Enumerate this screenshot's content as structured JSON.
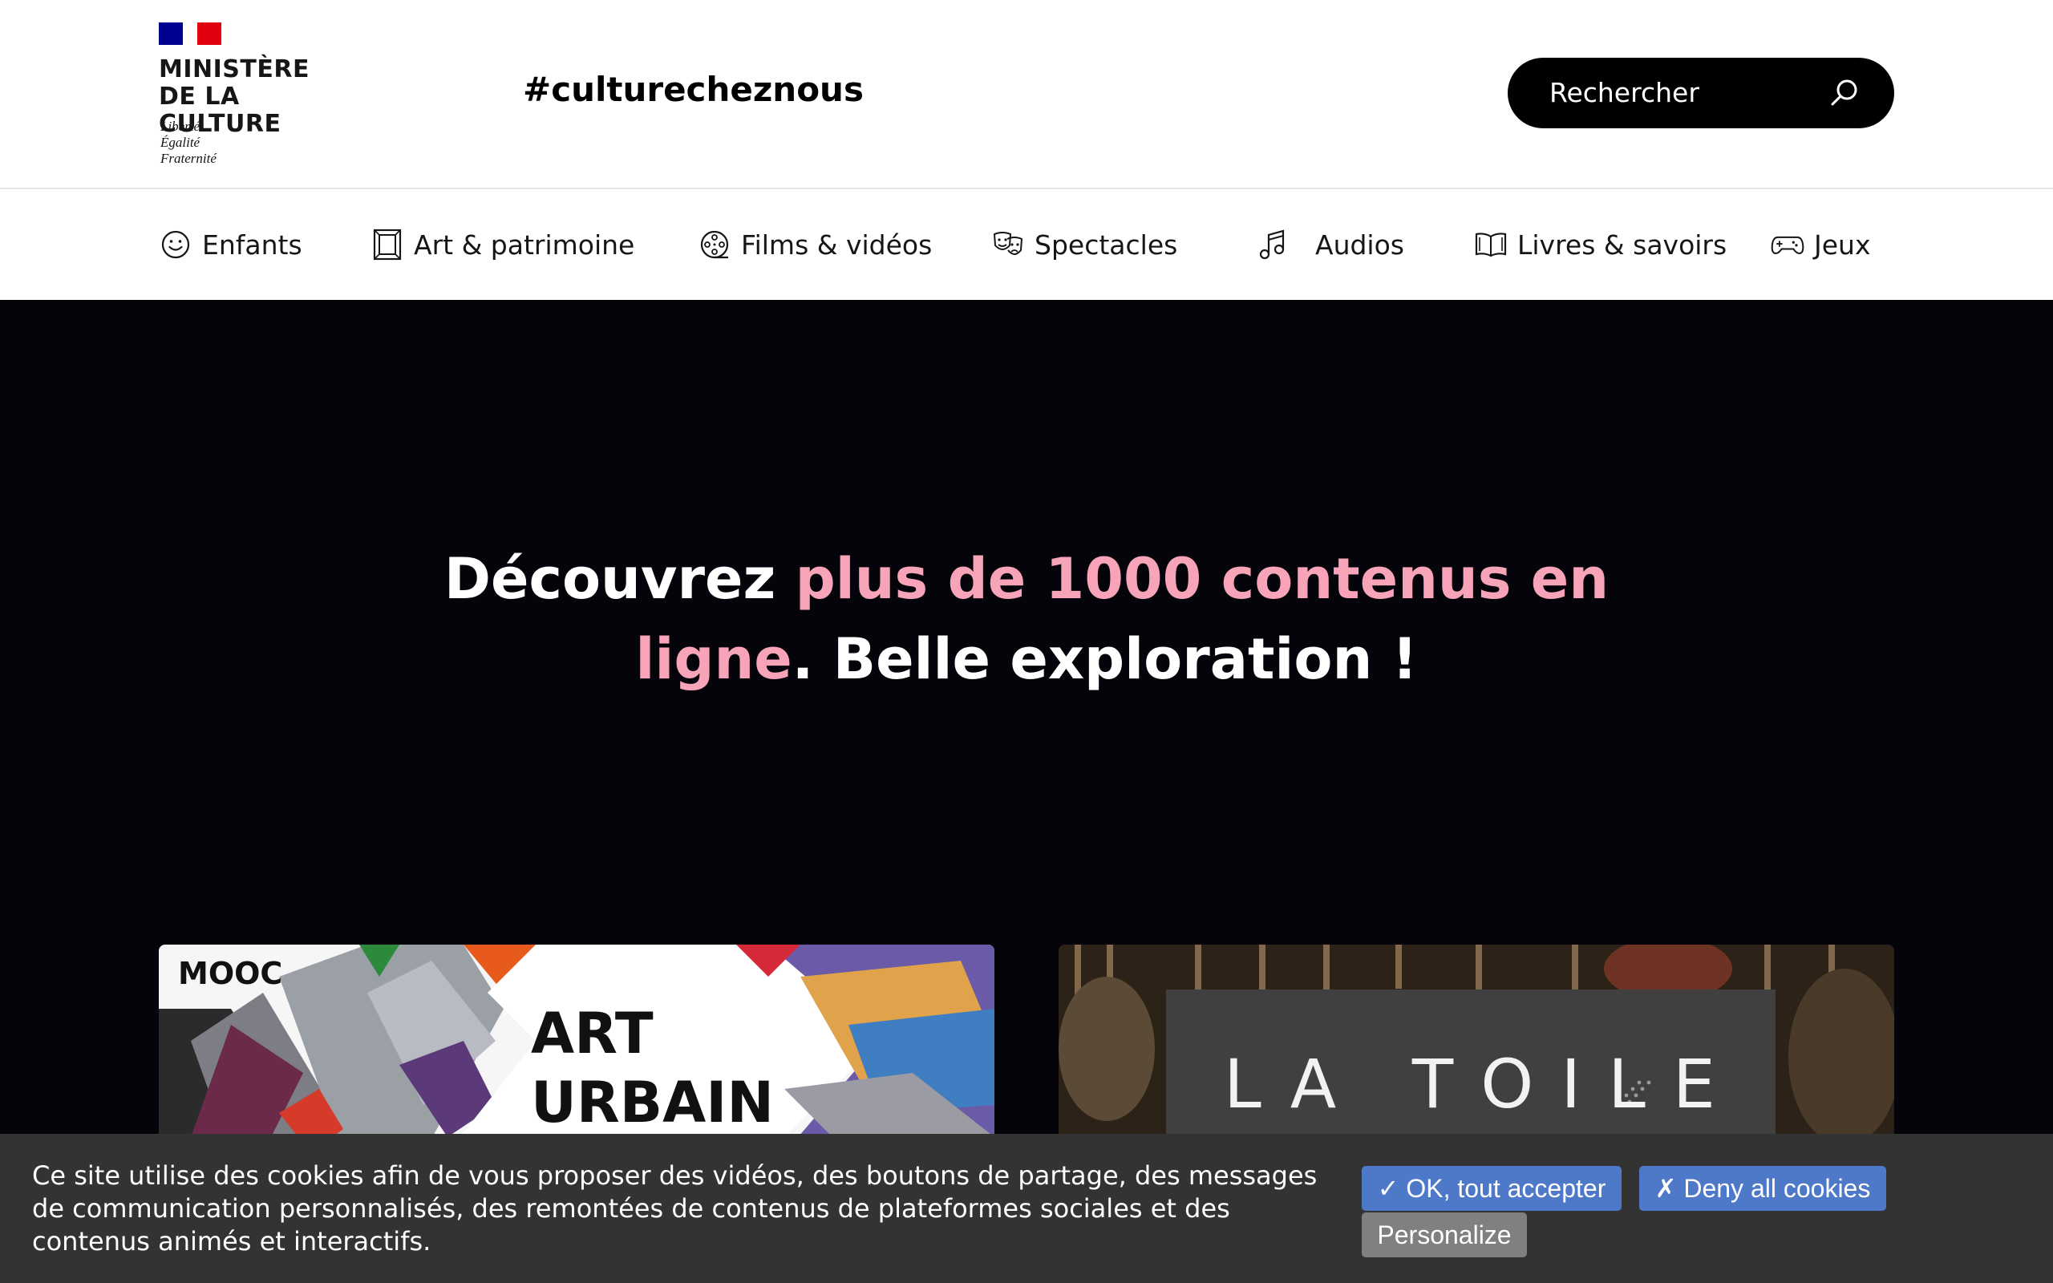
{
  "header": {
    "logo": {
      "title_line1": "MINISTÈRE",
      "title_line2": "DE LA CULTURE",
      "motto_line1": "Liberté",
      "motto_line2": "Égalité",
      "motto_line3": "Fraternité"
    },
    "hashtag": "#culturecheznous",
    "search": {
      "placeholder": "Rechercher",
      "icon": "search-icon"
    }
  },
  "nav": {
    "items": [
      {
        "label": "Enfants",
        "icon": "smiley-icon"
      },
      {
        "label": "Art & patrimoine",
        "icon": "picture-frame-icon"
      },
      {
        "label": "Films & vidéos",
        "icon": "film-reel-icon"
      },
      {
        "label": "Spectacles",
        "icon": "theater-masks-icon"
      },
      {
        "label": "Audios",
        "icon": "music-note-icon"
      },
      {
        "label": "Livres & savoirs",
        "icon": "open-book-icon"
      },
      {
        "label": "Jeux",
        "icon": "gamepad-icon"
      }
    ]
  },
  "hero": {
    "title_part1": "Découvrez ",
    "title_highlight1": "plus de 1000 contenus en",
    "title_highlight2": "ligne",
    "title_part2": ". Belle exploration !",
    "highlight_color": "#f7a3b8",
    "background_color": "#05040a"
  },
  "cards": [
    {
      "badge": "MOOC",
      "title_line1": "ART",
      "title_line2": "URBAIN"
    },
    {
      "title": "LA TOILE"
    }
  ],
  "cookie_banner": {
    "text": "Ce site utilise des cookies afin de vous proposer des vidéos, des boutons de partage, des messages de communication personnalisés, des remontées de contenus de plateformes sociales et des contenus animés et interactifs.",
    "accept_label": "✓ OK, tout accepter",
    "deny_label": "✗ Deny all cookies",
    "personalize_label": "Personalize",
    "button_color": "#4e79c8",
    "personalize_color": "#808080"
  }
}
